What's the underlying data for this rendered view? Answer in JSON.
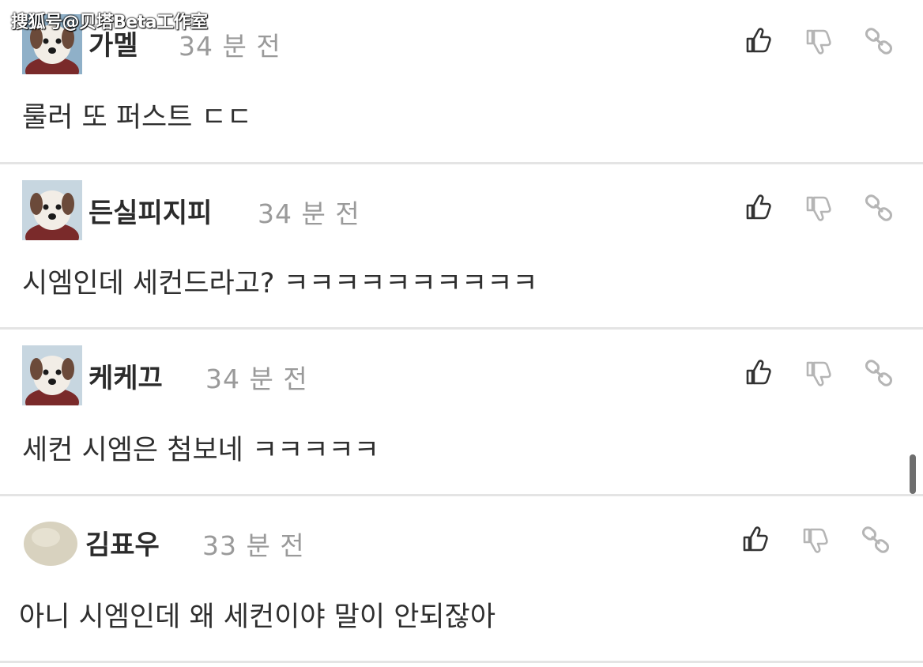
{
  "watermark": "搜狐号@贝塔Beta工作室",
  "comments": [
    {
      "username": "가멜",
      "time": "34 분 전",
      "text": "룰러 또 퍼스트 ㄷㄷ",
      "avatar": "dog-avatar"
    },
    {
      "username": "든실피지피",
      "time": "34 분 전",
      "text": "시엠인데 세컨드라고? ㅋㅋㅋㅋㅋㅋㅋㅋㅋㅋ",
      "avatar": "dog-avatar"
    },
    {
      "username": "케케끄",
      "time": "34 분 전",
      "text": "세컨 시엠은 첨보네 ㅋㅋㅋㅋㅋ",
      "avatar": "dog-avatar"
    },
    {
      "username": "김표우",
      "time": "33 분 전",
      "text": "아니 시엠인데 왜 세컨이야 말이 안되잖아",
      "avatar": "blob-avatar"
    }
  ],
  "icons": {
    "like": "thumbs-up-icon",
    "dislike": "thumbs-down-icon",
    "link": "link-icon"
  },
  "colors": {
    "username": "#2b2b2b",
    "time": "#9a9a9a",
    "divider": "#e4e4e4",
    "icon_dark": "#333333",
    "icon_light": "#b5b5b5"
  }
}
